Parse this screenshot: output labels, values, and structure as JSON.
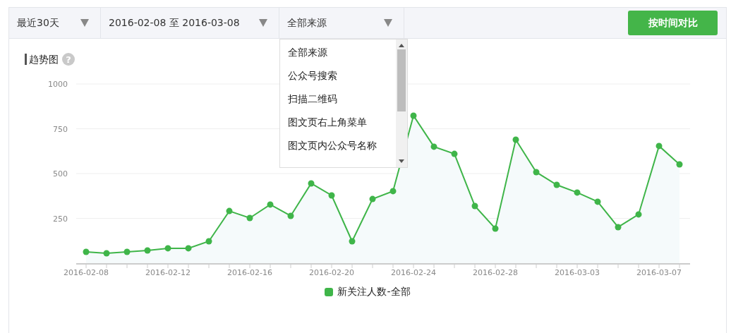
{
  "filters": [
    {
      "label": "最近30天"
    },
    {
      "label": "2016-02-08 至 2016-03-08"
    },
    {
      "label": "全部来源"
    }
  ],
  "compare_button": "按时间对比",
  "source_dropdown": {
    "items": [
      "全部来源",
      "公众号搜索",
      "扫描二维码",
      "图文页右上角菜单",
      "图文页内公众号名称"
    ]
  },
  "chart_section": {
    "title": "趋势图",
    "help_icon": "?",
    "chart_data": {
      "type": "area",
      "grid": true,
      "ylim": [
        0,
        1000
      ],
      "yticks": [
        250,
        500,
        750,
        1000
      ],
      "categories": [
        "2016-02-08",
        null,
        null,
        null,
        "2016-02-12",
        null,
        null,
        null,
        "2016-02-16",
        null,
        null,
        null,
        "2016-02-20",
        null,
        null,
        null,
        "2016-02-24",
        null,
        null,
        null,
        "2016-02-28",
        null,
        null,
        null,
        "2016-03-03",
        null,
        null,
        null,
        "2016-03-07",
        null
      ],
      "series": [
        {
          "name": "新关注人数-全部",
          "color": "#3fb549",
          "values": [
            63,
            55,
            63,
            71,
            83,
            83,
            122,
            291,
            252,
            327,
            264,
            445,
            378,
            122,
            358,
            402,
            823,
            650,
            610,
            319,
            193,
            689,
            508,
            437,
            394,
            343,
            201,
            272,
            654,
            551
          ]
        }
      ]
    }
  }
}
